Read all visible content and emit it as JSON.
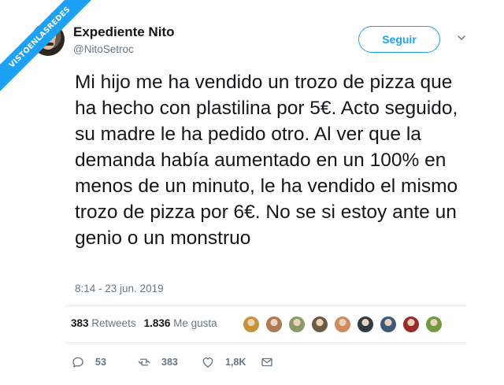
{
  "watermark": {
    "text": "VISTOENLASREDES"
  },
  "author": {
    "display_name": "Expediente Nito",
    "handle": "@NitoSetroc",
    "avatar_icon": "user-avatar"
  },
  "follow_button": {
    "label": "Seguir"
  },
  "menu_icon": "chevron-down-icon",
  "tweet": {
    "text": "Mi hijo me ha vendido un trozo de pizza que ha hecho con plastilina por 5€. Acto seguido, su madre le ha pedido otro. Al ver que la demanda había aumentado en un 100% en menos de un minuto, le ha vendido el mismo trozo de pizza por 6€. No se si estoy ante un genio o un monstruo",
    "timestamp": "8:14 - 23 jun. 2019"
  },
  "stats": {
    "retweets_count": "383",
    "retweets_label": "Retweets",
    "likes_count": "1.836",
    "likes_label": "Me gusta"
  },
  "likers_colors": [
    "#c9923a",
    "#b07a52",
    "#8a9a6a",
    "#6f5a44",
    "#d08a60",
    "#2f3b44",
    "#3e5a7a",
    "#9b2a2a",
    "#6f9a3e"
  ],
  "actions": {
    "reply_count": "53",
    "retweet_count": "383",
    "like_count": "1,8K"
  },
  "colors": {
    "accent": "#1da1f2",
    "muted": "#657786",
    "text": "#14171a"
  }
}
